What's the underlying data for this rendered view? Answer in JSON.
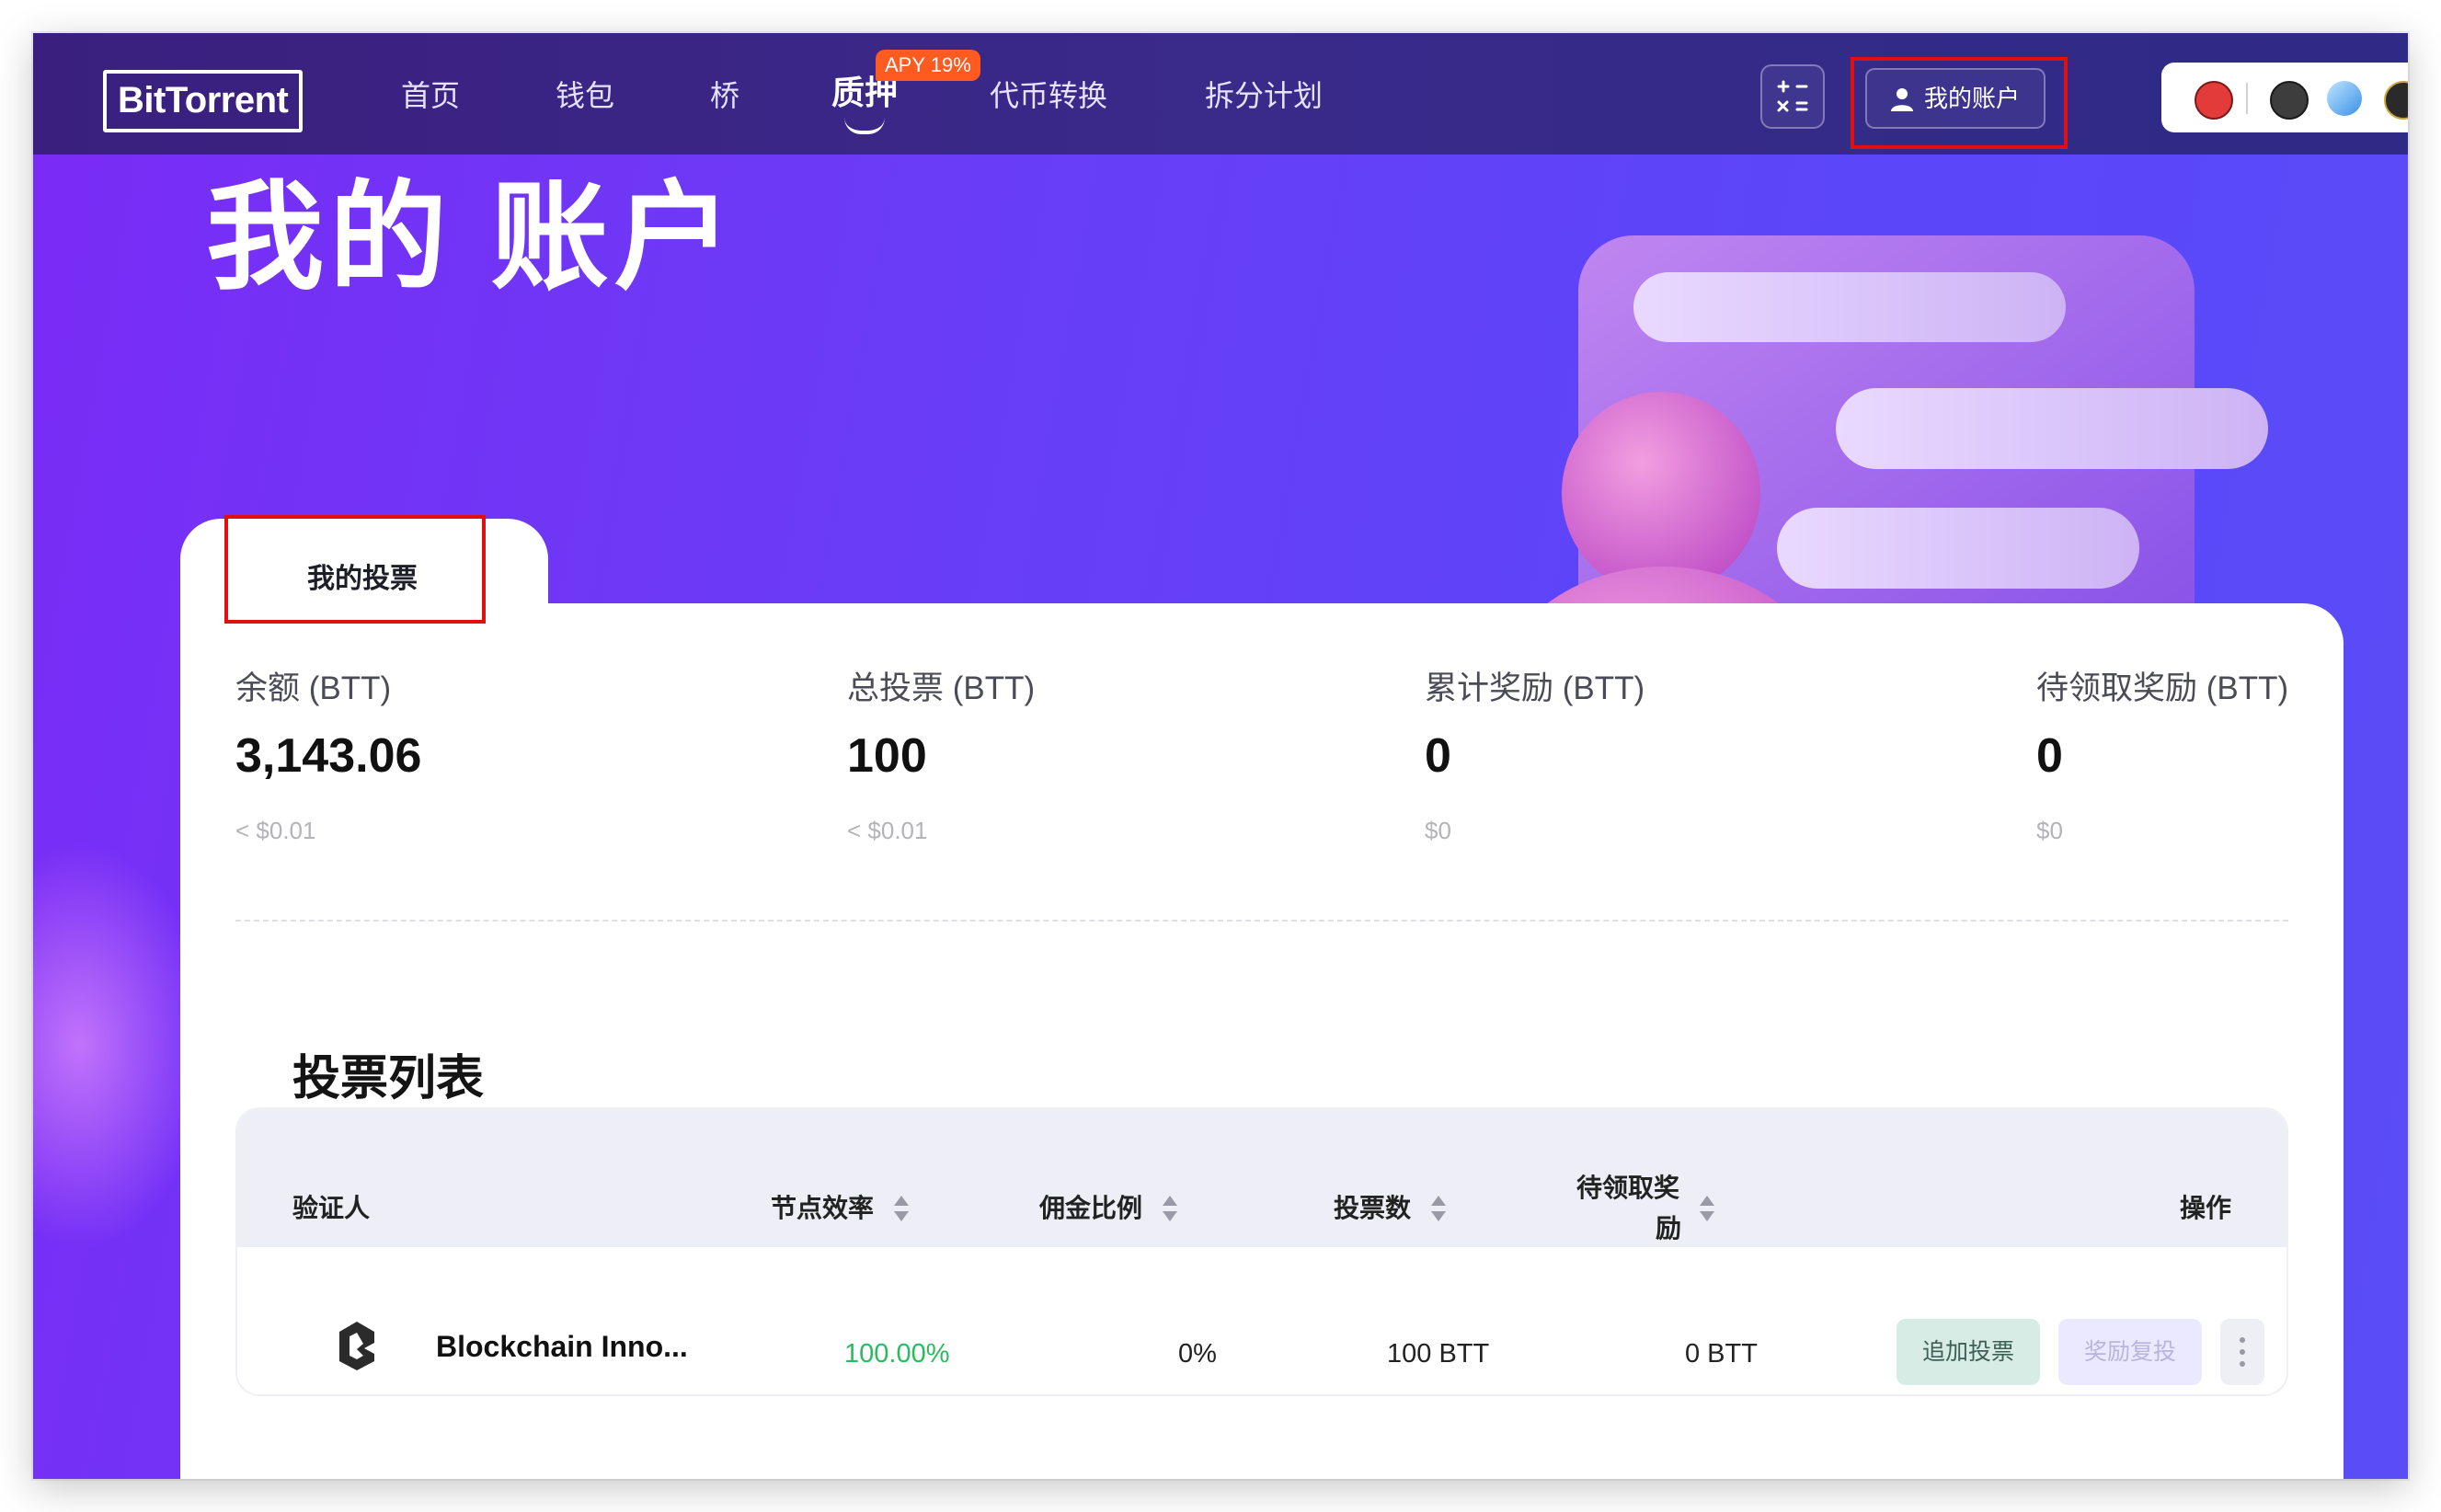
{
  "nav": {
    "logo": "BitTorrent",
    "links": [
      "首页",
      "钱包",
      "桥",
      "质押",
      "代币转换",
      "拆分计划"
    ],
    "active": "质押",
    "apy_badge": "APY 19%",
    "account_button": "我的账户",
    "icons": {
      "calculator": "calculator-icon",
      "user": "user-icon",
      "wallets": [
        "wallet-icon-1",
        "wallet-icon-2",
        "wallet-icon-3",
        "wallet-icon-4"
      ]
    }
  },
  "hero": {
    "title": "我的 账户"
  },
  "tab": {
    "label": "我的投票"
  },
  "stats": [
    {
      "label": "余额 (BTT)",
      "value": "3,143.06",
      "sub": "< $0.01"
    },
    {
      "label": "总投票 (BTT)",
      "value": "100",
      "sub": "< $0.01"
    },
    {
      "label": "累计奖励 (BTT)",
      "value": "0",
      "sub": "$0"
    },
    {
      "label": "待领取奖励 (BTT)",
      "value": "0",
      "sub": "$0"
    }
  ],
  "vote_list": {
    "title": "投票列表",
    "headers": {
      "validator": "验证人",
      "efficiency": "节点效率",
      "commission": "佣金比例",
      "votes": "投票数",
      "pending_line1": "待领取奖",
      "pending_line2": "励",
      "actions": "操作"
    },
    "rows": [
      {
        "validator": "Blockchain Inno...",
        "efficiency": "100.00%",
        "commission": "0%",
        "votes": "100 BTT",
        "pending": "0 BTT",
        "add_vote": "追加投票",
        "reinvest": "奖励复投"
      }
    ]
  },
  "colors": {
    "accent_purple": "#6a3cf7",
    "nav_bg": "#3a2a8a",
    "apy_orange": "#ff5a1f",
    "efficiency_green": "#2bbb5f",
    "highlight_red": "#e01010"
  }
}
